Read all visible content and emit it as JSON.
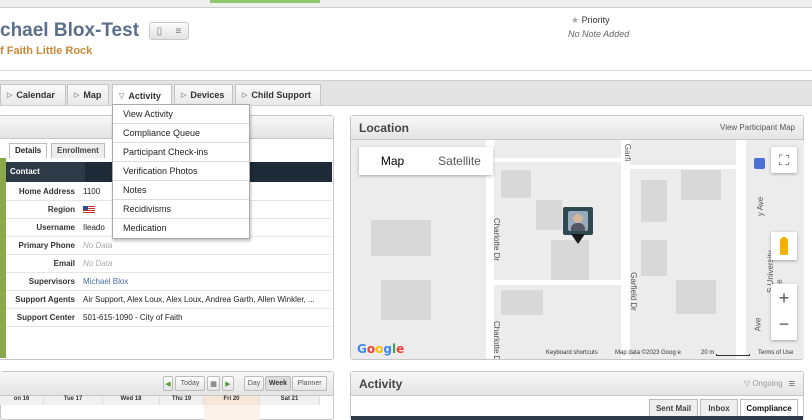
{
  "header": {
    "participant_name": "chael Blox-Test",
    "organization": "f Faith Little Rock",
    "priority_label": "Priority",
    "note": "No Note Added"
  },
  "nav": {
    "tabs": [
      {
        "label": "Calendar"
      },
      {
        "label": "Map"
      },
      {
        "label": "Activity",
        "active": true
      },
      {
        "label": "Devices"
      },
      {
        "label": "Child Support"
      }
    ],
    "activity_menu": [
      "View Activity",
      "Compliance Queue",
      "Participant Check-ins",
      "Verification Photos",
      "Notes",
      "Recidivisms",
      "Medication"
    ]
  },
  "details": {
    "subtabs": [
      "Details",
      "Enrollment"
    ],
    "section": "Contact",
    "rows": [
      {
        "label": "Home Address",
        "value": "1100"
      },
      {
        "label": "Region",
        "value": ""
      },
      {
        "label": "Username",
        "value": "Ileado"
      },
      {
        "label": "Primary Phone",
        "value": "No Data"
      },
      {
        "label": "Email",
        "value": "No Data"
      },
      {
        "label": "Supervisors",
        "value": "Michael Blox"
      },
      {
        "label": "Support Agents",
        "value": "Air Support, Alex Loux, Alex Loux, Andrea Garth, Allen Winkler, ..."
      },
      {
        "label": "Support Center",
        "value": "501-615-1090 - City of Faith"
      }
    ]
  },
  "location": {
    "title": "Location",
    "link": "View Participant Map",
    "map_type_map": "Map",
    "map_type_satellite": "Satellite",
    "streets": [
      "Charlotte Dr",
      "Charlotte Dr",
      "Garfield Dr",
      "Garfi",
      "S University Ave",
      "y Ave",
      "Ave"
    ],
    "google_logo": "Google",
    "keyboard": "Keyboard shortcuts",
    "map_data": "Map data ©2023 Goog e",
    "scale": "20 m",
    "terms": "Terms of Use"
  },
  "calendar": {
    "today": "Today",
    "views": [
      "Day",
      "Week",
      "Planner"
    ],
    "days": [
      "on 16",
      "Tue 17",
      "Wed 18",
      "Thu 19",
      "Fri 20",
      "Sat 21"
    ]
  },
  "activity": {
    "title": "Activity",
    "filter": "Ongoing",
    "tabs": [
      "Sent Mail",
      "Inbox",
      "Compliance"
    ]
  },
  "colors": {
    "name": "#5a6f8a",
    "org": "#c8893a",
    "contact_bar": "#2f3a48",
    "accent_green": "#8aa84c"
  }
}
